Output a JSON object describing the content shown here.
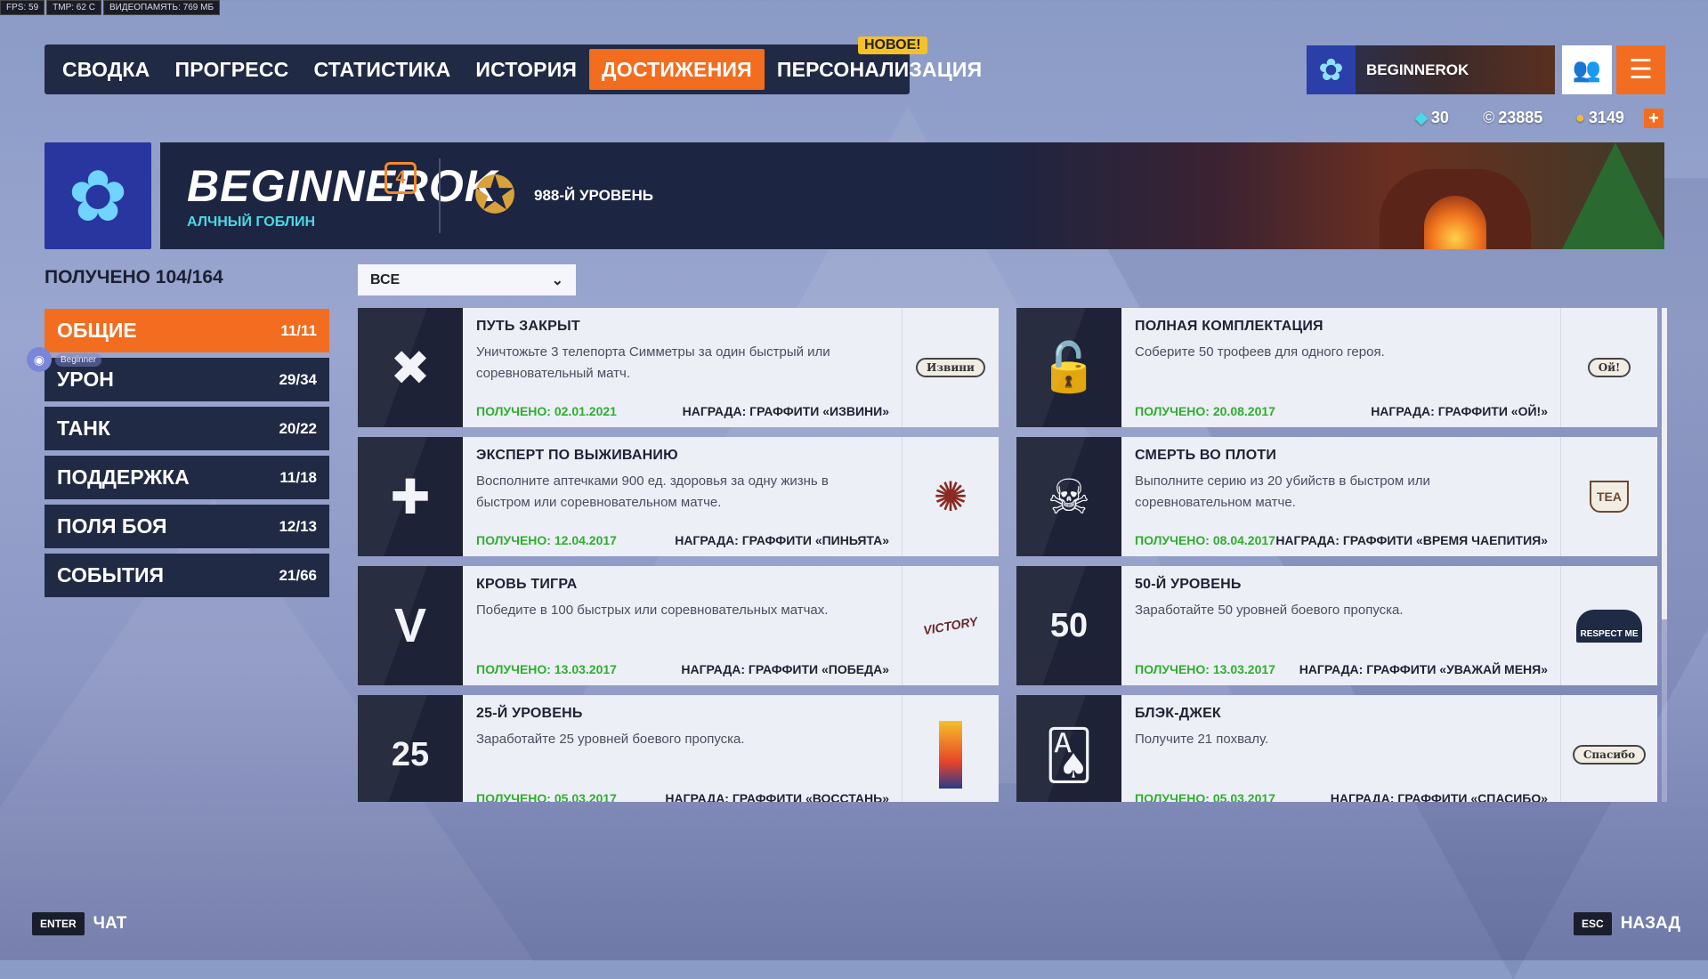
{
  "debug": {
    "fps": "FPS: 59",
    "tmp": "TMP: 62 C",
    "vram": "ВИДЕОПАМЯТЬ: 769 МБ"
  },
  "nav": {
    "tabs": [
      {
        "label": "СВОДКА"
      },
      {
        "label": "ПРОГРЕСС"
      },
      {
        "label": "СТАТИСТИКА"
      },
      {
        "label": "ИСТОРИЯ"
      },
      {
        "label": "ДОСТИЖЕНИЯ",
        "active": true
      },
      {
        "label": "ПЕРСОНАЛИЗАЦИЯ"
      }
    ],
    "new_badge": "НОВОЕ!"
  },
  "player": {
    "name": "BEGINNEROK"
  },
  "currency": {
    "legacy": "30",
    "coins": "23885",
    "credits": "3149"
  },
  "profile": {
    "name": "BEGINNEROK",
    "prestige": "4",
    "title": "АЛЧНЫЙ ГОБЛИН",
    "level": "988-Й УРОВЕНЬ"
  },
  "received": "ПОЛУЧЕНО 104/164",
  "categories": [
    {
      "label": "ОБЩИЕ",
      "count": "11/11",
      "active": true
    },
    {
      "label": "УРОН",
      "count": "29/34"
    },
    {
      "label": "ТАНК",
      "count": "20/22"
    },
    {
      "label": "ПОДДЕРЖКА",
      "count": "11/18"
    },
    {
      "label": "ПОЛЯ БОЯ",
      "count": "12/13"
    },
    {
      "label": "СОБЫТИЯ",
      "count": "21/66"
    }
  ],
  "discord": {
    "name": "Beginner"
  },
  "filter": {
    "value": "ВСЕ"
  },
  "achievements": [
    {
      "title": "ПУТЬ ЗАКРЫТ",
      "desc": "Уничтожьте 3 телепорта Симметры за один быстрый или соревновательный матч.",
      "date": "ПОЛУЧЕНО: 02.01.2021",
      "reward": "НАГРАДА: ГРАФФИТИ «ИЗВИНИ»",
      "icon": "crossed-out-icon",
      "thumb_text": "Извини"
    },
    {
      "title": "ПОЛНАЯ КОМПЛЕКТАЦИЯ",
      "desc": "Соберите 50 трофеев для одного героя.",
      "date": "ПОЛУЧЕНО: 20.08.2017",
      "reward": "НАГРАДА: ГРАФФИТИ «ОЙ!»",
      "icon": "padlock-icon",
      "thumb_text": "Ой!"
    },
    {
      "title": "ЭКСПЕРТ ПО ВЫЖИВАНИЮ",
      "desc": "Восполните аптечками 900 ед. здоровья за одну жизнь в быстром или соревновательном матче.",
      "date": "ПОЛУЧЕНО: 12.04.2017",
      "reward": "НАГРАДА: ГРАФФИТИ «ПИНЬЯТА»",
      "icon": "medkit-icon",
      "thumb_text": ""
    },
    {
      "title": "СМЕРТЬ ВО ПЛОТИ",
      "desc": "Выполните серию из 20 убийств в быстром или соревновательном матче.",
      "date": "ПОЛУЧЕНО: 08.04.2017",
      "reward": "НАГРАДА: ГРАФФИТИ «ВРЕМЯ ЧАЕПИТИЯ»",
      "icon": "skulls-icon",
      "thumb_text": "TEA"
    },
    {
      "title": "КРОВЬ ТИГРА",
      "desc": "Победите в 100 быстрых или соревновательных матчах.",
      "date": "ПОЛУЧЕНО: 13.03.2017",
      "reward": "НАГРАДА: ГРАФФИТИ «ПОБЕДА»",
      "icon": "victory-wings-icon",
      "thumb_text": "VICTORY"
    },
    {
      "title": "50-Й УРОВЕНЬ",
      "desc": "Заработайте 50 уровней боевого пропуска.",
      "date": "ПОЛУЧЕНО: 13.03.2017",
      "reward": "НАГРАДА: ГРАФФИТИ «УВАЖАЙ МЕНЯ»",
      "icon": "level-50-icon",
      "thumb_text": "RESPECT ME"
    },
    {
      "title": "25-Й УРОВЕНЬ",
      "desc": "Заработайте 25 уровней боевого пропуска.",
      "date": "ПОЛУЧЕНО: 05.03.2017",
      "reward": "НАГРАДА: ГРАФФИТИ «ВОССТАНЬ»",
      "icon": "level-25-icon",
      "thumb_text": ""
    },
    {
      "title": "БЛЭК-ДЖЕК",
      "desc": "Получите 21 похвалу.",
      "date": "ПОЛУЧЕНО: 05.03.2017",
      "reward": "НАГРАДА: ГРАФФИТИ «СПАСИБО»",
      "icon": "cards-icon",
      "thumb_text": "Спасибо"
    }
  ],
  "hints": {
    "chat_key": "ENTER",
    "chat_label": "ЧАТ",
    "back_key": "ESC",
    "back_label": "НАЗАД"
  },
  "colors": {
    "accent": "#f26d1f",
    "panel": "#212a44",
    "received_green": "#2fae2f",
    "title_cyan": "#4ad8e6"
  }
}
